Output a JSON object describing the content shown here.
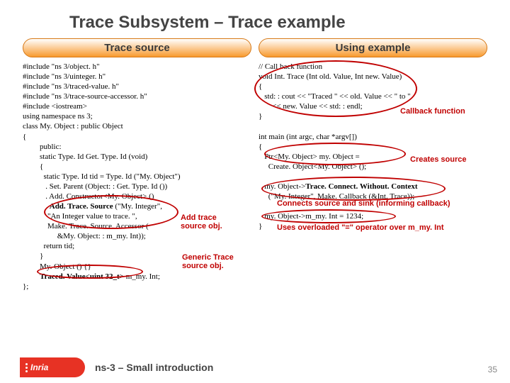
{
  "title": "Trace Subsystem – Trace example",
  "leftTab": "Trace source",
  "rightTab": "Using example",
  "left": {
    "l0": "#include \"ns 3/object. h\"",
    "l1": "#include \"ns 3/uinteger. h\"",
    "l2": "#include \"ns 3/traced-value. h\"",
    "l3": "#include \"ns 3/trace-source-accessor. h\"",
    "l4": "#include <iostream>",
    "l5": "using namespace ns 3;",
    "l6": "class My. Object : public Object",
    "l7": "{",
    "l8": "public:",
    "l9": "static Type. Id Get. Type. Id (void)",
    "l10": "{",
    "l11": "  static Type. Id tid = Type. Id (\"My. Object\")",
    "l12": "   . Set. Parent (Object: : Get. Type. Id ())",
    "l13": "   . Add. Constructor<My. Object> ()",
    "l14a": "   . ",
    "l14b": "Add. Trace. Source",
    "l14c": " (\"My. Integer\",",
    "l15": "    \"An Integer value to trace. \",",
    "l16": "    Make. Trace. Source. Accessor (",
    "l17": "         &My. Object: : m_my. Int));",
    "l18": "  return tid;",
    "l19": "}",
    "l20": "My. Object () {}",
    "l21a": "Traced. Value<uint 32_t>",
    "l21b": " m_my. Int;",
    "l22": "};"
  },
  "right": {
    "r0": "// Call back function",
    "r1": "void Int. Trace (Int old. Value, Int new. Value)",
    "r2": "{",
    "r3": "   std: : cout << \"Traced \" << old. Value << \" to \"",
    "r4": "       << new. Value << std: : endl;",
    "r5": "}",
    "r7": "int main (int argc, char *argv[])",
    "r8": "{",
    "r9": "   Ptr<My. Object> my. Object =",
    "r10": "     Create. Object<My. Object> ();",
    "r12a": "   my. Object->",
    "r12b": "Trace. Connect. Without. Context",
    "r13": "     (\"My. Integer\", Make. Callback (&Int. Trace));",
    "r15": "   my. Object->m_my. Int = 1234;",
    "r16": "}"
  },
  "callouts": {
    "addTrace": "Add trace source obj.",
    "generic": "Generic Trace source obj.",
    "callback": "Callback function",
    "creates": "Creates source",
    "connects": "Connects source and sink (informing callback)",
    "overload": "Uses overloaded \"=\" operator over  m_my. Int"
  },
  "footer": {
    "logo": "Inria",
    "text": "ns-3 – Small introduction",
    "page": "35"
  }
}
